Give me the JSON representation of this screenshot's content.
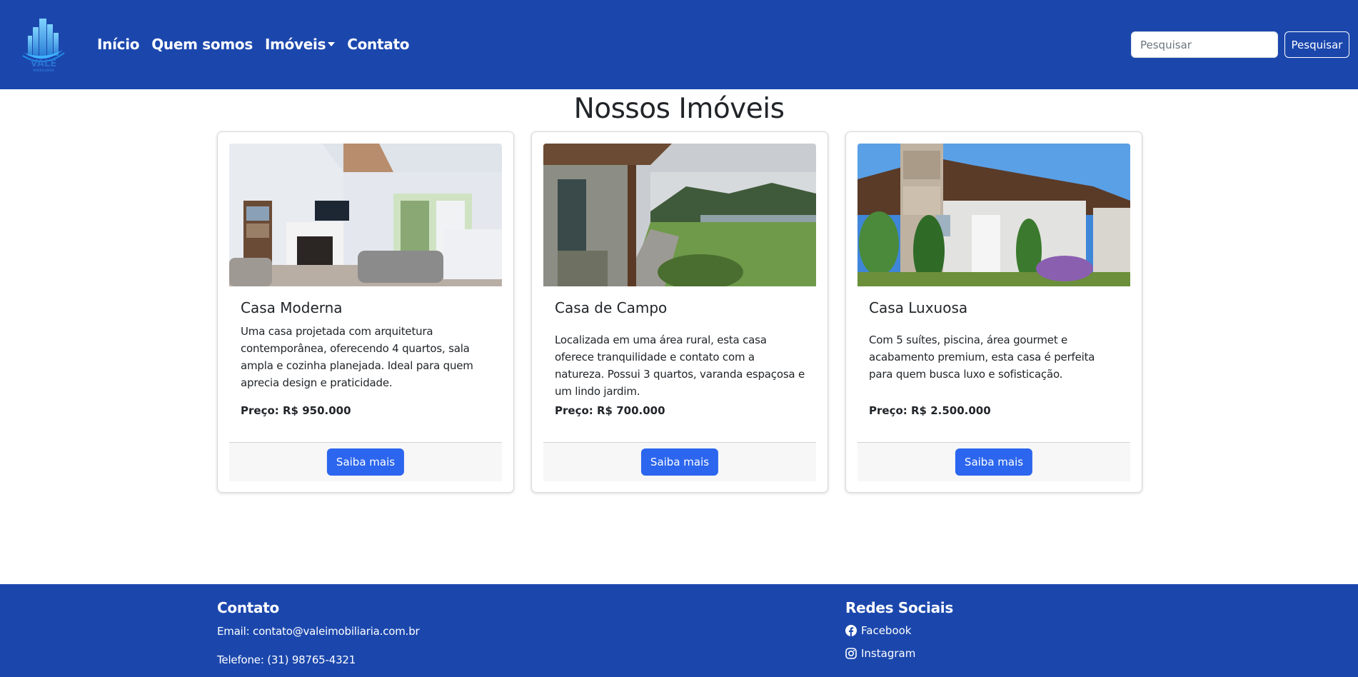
{
  "navbar": {
    "logo": {
      "text": "VALE",
      "subtext": "IMOBILIÁRIA"
    },
    "links": [
      {
        "label": "Início"
      },
      {
        "label": "Quem somos"
      },
      {
        "label": "Imóveis",
        "dropdown": true
      },
      {
        "label": "Contato"
      }
    ],
    "search": {
      "placeholder": "Pesquisar",
      "value": "",
      "button_label": "Pesquisar"
    },
    "background_color": "#1b47ad"
  },
  "main": {
    "title": "Nossos Imóveis",
    "cards": [
      {
        "title": "Casa Moderna",
        "description": "Uma casa projetada com arquitetura contemporânea, oferecendo 4 quartos, sala ampla e cozinha planejada. Ideal para quem aprecia design e praticidade.",
        "price": "Preço: R$ 950.000",
        "button_label": "Saiba mais"
      },
      {
        "title": "Casa de Campo",
        "description": "Localizada em uma área rural, esta casa oferece tranquilidade e contato com a natureza. Possui 3 quartos, varanda espaçosa e um lindo jardim.",
        "price": "Preço: R$ 700.000",
        "button_label": "Saiba mais"
      },
      {
        "title": "Casa Luxuosa",
        "description": "Com 5 suítes, piscina, área gourmet e acabamento premium, esta casa é perfeita para quem busca luxo e sofisticação.",
        "price": "Preço: R$ 2.500.000",
        "button_label": "Saiba mais"
      }
    ],
    "button_color": "#2c66ee"
  },
  "footer": {
    "contact": {
      "heading": "Contato",
      "email": "Email: contato@valeimobiliaria.com.br",
      "phone": "Telefone: (31) 98765-4321"
    },
    "social": {
      "heading": "Redes Sociais",
      "links": [
        {
          "label": "Facebook",
          "icon": "facebook-icon"
        },
        {
          "label": "Instagram",
          "icon": "instagram-icon"
        }
      ]
    },
    "background_color": "#1b47ad"
  }
}
